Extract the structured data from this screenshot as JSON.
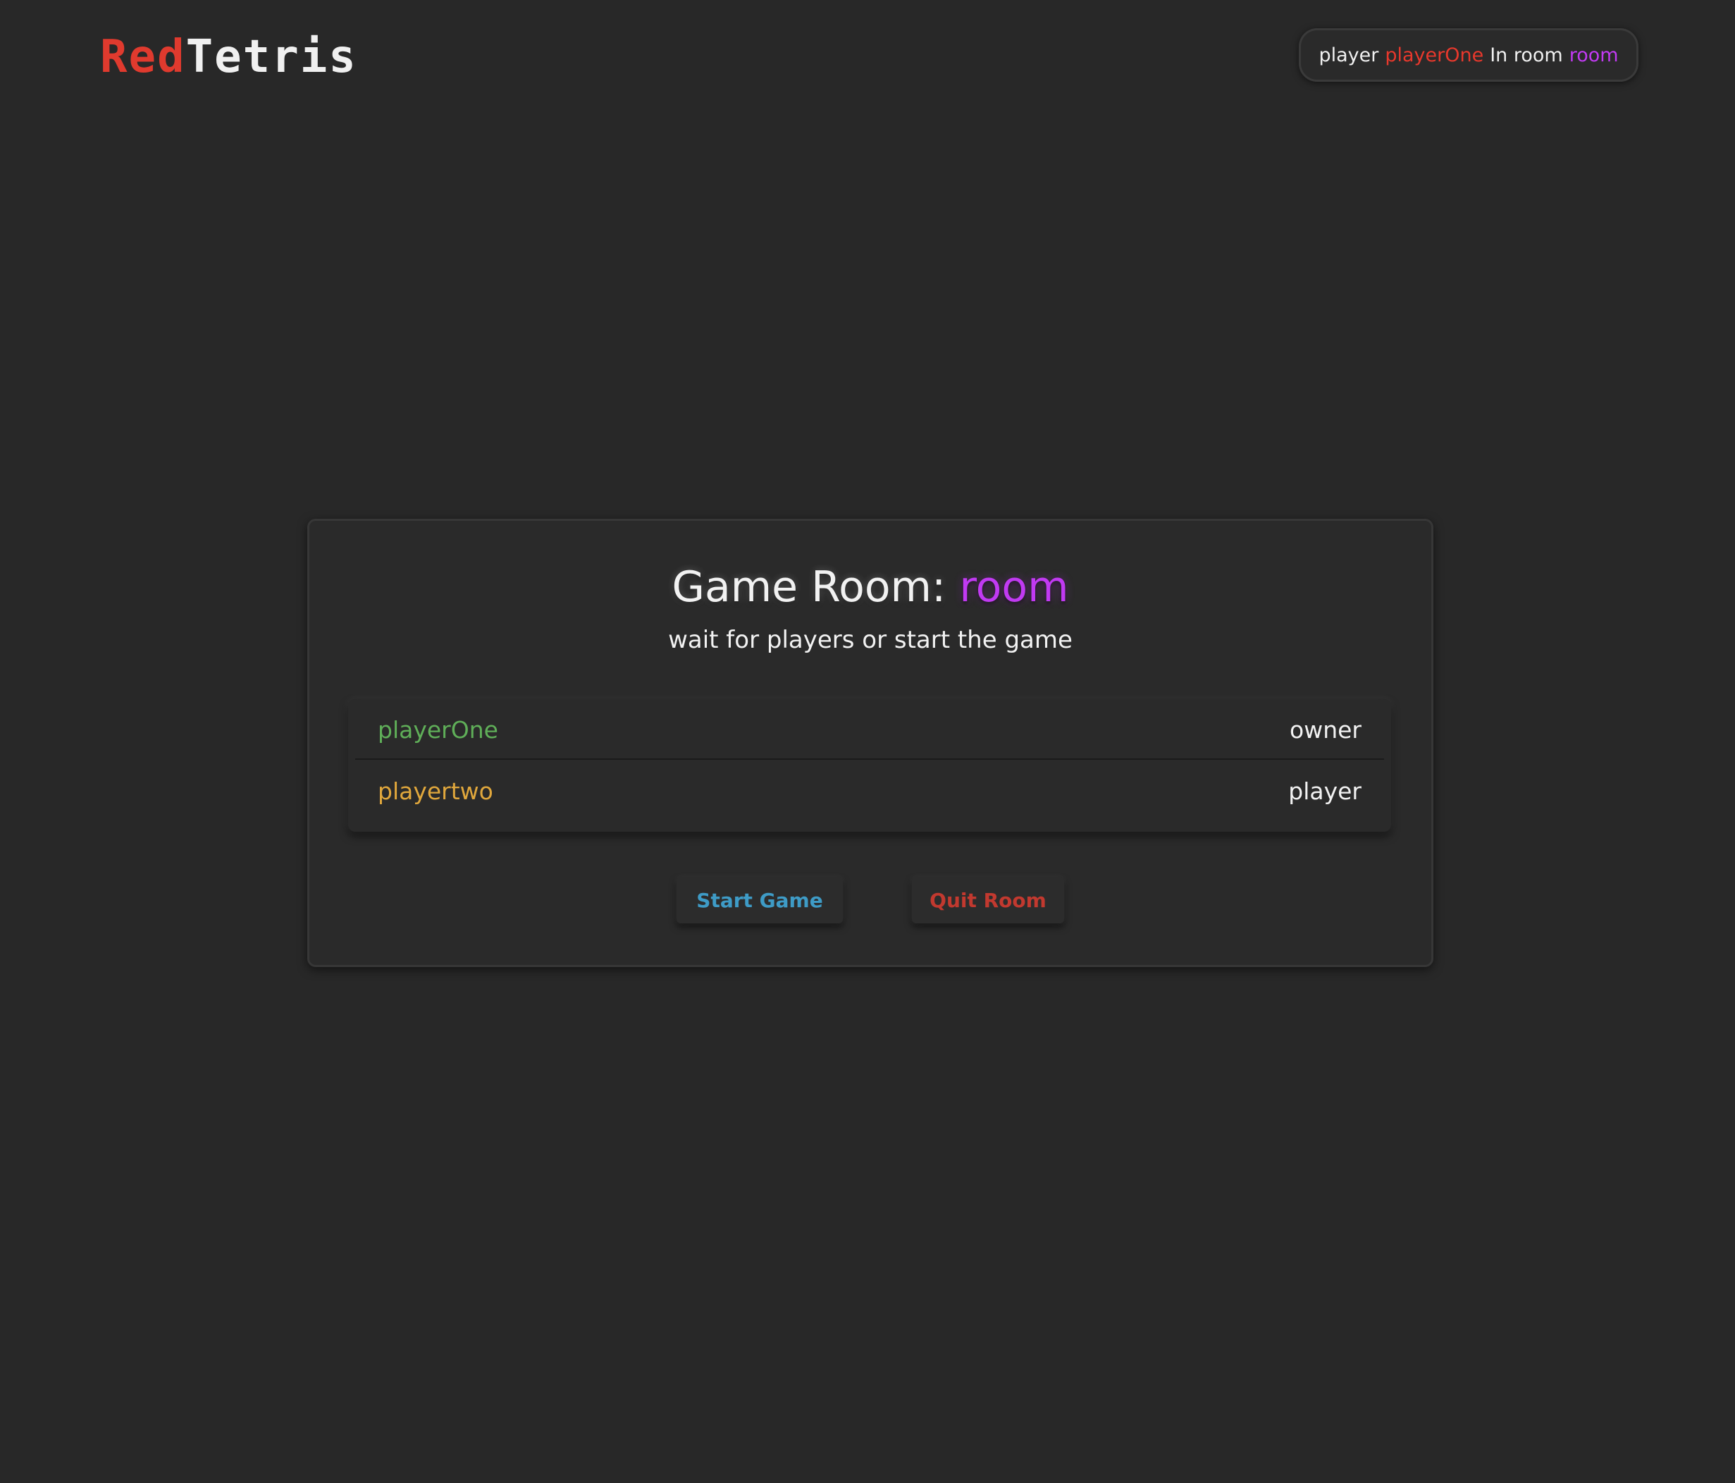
{
  "header": {
    "logo": {
      "part1": "Red",
      "part2": "Tetris"
    },
    "session": {
      "player_label": "player",
      "player_name": "playerOne",
      "room_label": "In room",
      "room_name": "room"
    }
  },
  "room": {
    "title_label": "Game Room:",
    "title_room": "room",
    "subtitle": "wait for players or start the game",
    "players": [
      {
        "name": "playerOne",
        "role": "owner",
        "color": "#5fae58"
      },
      {
        "name": "playertwo",
        "role": "player",
        "color": "#e0a73c"
      }
    ],
    "actions": {
      "start_label": "Start Game",
      "quit_label": "Quit Room"
    }
  },
  "colors": {
    "background": "#282828",
    "accent_red": "#e8382c",
    "accent_purple": "#c13af2",
    "start_blue": "#3e9bc6",
    "quit_red": "#c2392f"
  }
}
